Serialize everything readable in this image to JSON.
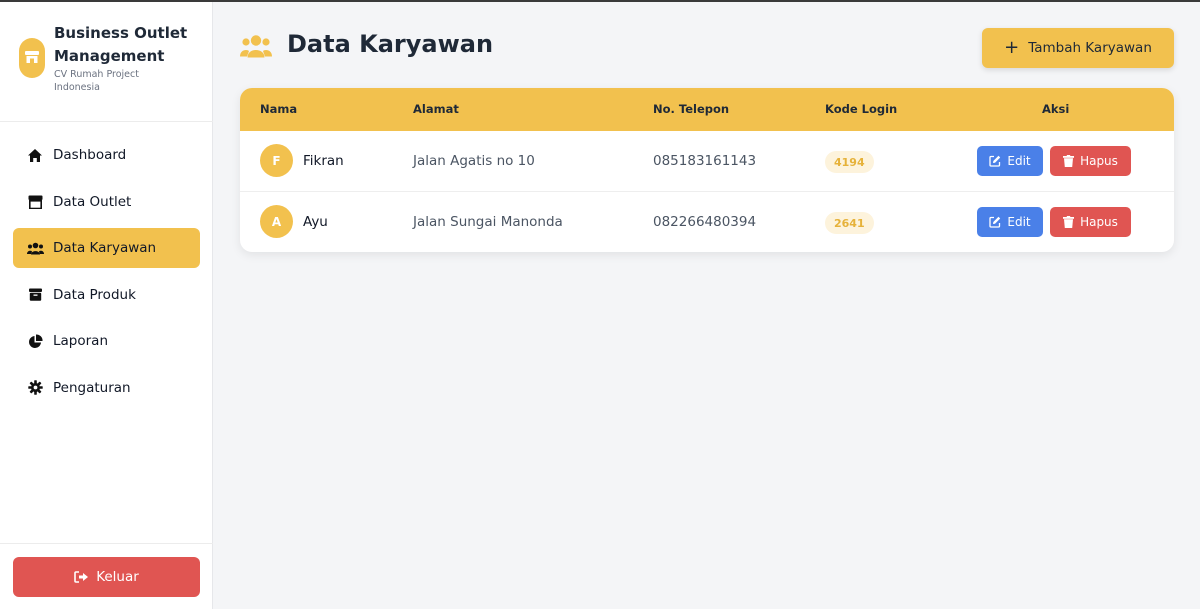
{
  "brand": {
    "title": "Business Outlet Management",
    "subtitle": "CV Rumah Project Indonesia",
    "logo_icon": "store-icon"
  },
  "nav": {
    "items": [
      {
        "label": "Dashboard",
        "icon": "home-icon",
        "active": false
      },
      {
        "label": "Data Outlet",
        "icon": "store-icon",
        "active": false
      },
      {
        "label": "Data Karyawan",
        "icon": "users-icon",
        "active": true
      },
      {
        "label": "Data Produk",
        "icon": "box-icon",
        "active": false
      },
      {
        "label": "Laporan",
        "icon": "pie-chart-icon",
        "active": false
      },
      {
        "label": "Pengaturan",
        "icon": "gear-icon",
        "active": false
      }
    ]
  },
  "footer": {
    "logout_label": "Keluar"
  },
  "page": {
    "title": "Data Karyawan",
    "add_button_label": "Tambah Karyawan"
  },
  "table": {
    "columns": [
      "Nama",
      "Alamat",
      "No. Telepon",
      "Kode Login",
      "Aksi"
    ],
    "rows": [
      {
        "initial": "F",
        "name": "Fikran",
        "address": "Jalan Agatis no 10",
        "phone": "085183161143",
        "code": "4194"
      },
      {
        "initial": "A",
        "name": "Ayu",
        "address": "Jalan Sungai Manonda",
        "phone": "082266480394",
        "code": "2641"
      }
    ],
    "edit_label": "Edit",
    "delete_label": "Hapus"
  },
  "colors": {
    "accent": "#f2c14e",
    "danger": "#e05552",
    "primary": "#4a80e8"
  }
}
